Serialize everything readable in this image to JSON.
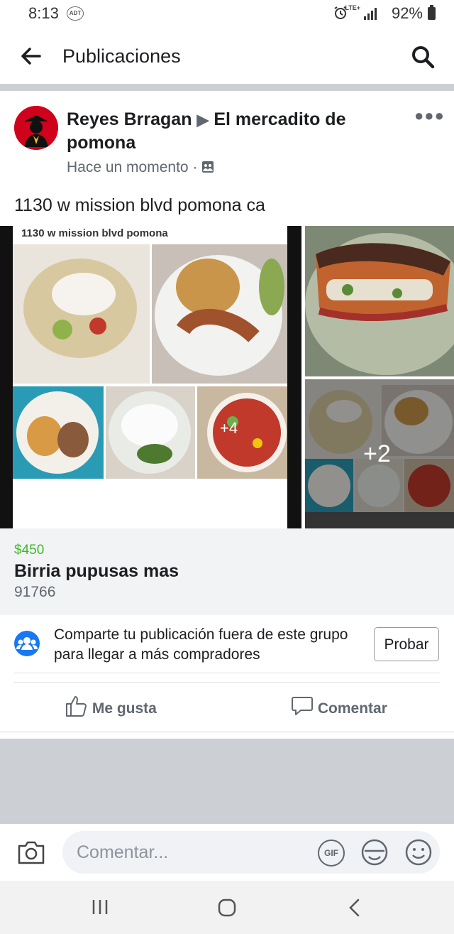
{
  "status_bar": {
    "time": "8:13",
    "network": "LTE+",
    "battery": "92%"
  },
  "header": {
    "title": "Publicaciones"
  },
  "post": {
    "author": "Reyes Brragan",
    "group": "El mercadito de pomona",
    "timestamp": "Hace un momento",
    "caption": "1130 w mission blvd pomona ca",
    "photo_caption": "1130 w mission blvd pomona",
    "photo_overlay_count": "+4",
    "more_photos_count": "+2"
  },
  "listing": {
    "price": "$450",
    "title": "Birria pupusas mas",
    "zip": "91766"
  },
  "share_prompt": {
    "text": "Comparte tu publicación fuera de este grupo para llegar a más compradores",
    "button": "Probar"
  },
  "actions": {
    "like": "Me gusta",
    "comment": "Comentar"
  },
  "comment_bar": {
    "placeholder": "Comentar...",
    "gif_label": "GIF"
  },
  "colors": {
    "accent": "#1877f2",
    "price": "#42b72a",
    "avatar": "#d0021b"
  }
}
